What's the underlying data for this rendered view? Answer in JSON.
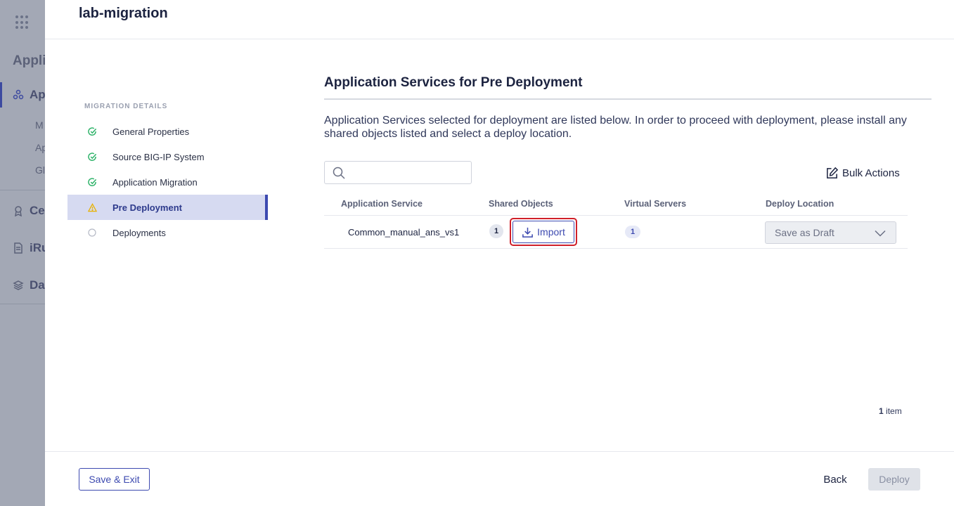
{
  "background": {
    "title": "Appli",
    "nav": [
      {
        "label": "Ap",
        "icon": "applications-icon",
        "active": true
      },
      {
        "label": "Ce",
        "icon": "certificates-icon"
      },
      {
        "label": "iRu",
        "icon": "irules-icon"
      },
      {
        "label": "Da",
        "icon": "data-icon"
      }
    ],
    "sub": [
      "M",
      "Ap",
      "Gl"
    ]
  },
  "header": {
    "title": "lab-migration"
  },
  "steps": {
    "label": "MIGRATION DETAILS",
    "items": [
      {
        "label": "General Properties",
        "status": "done"
      },
      {
        "label": "Source BIG-IP System",
        "status": "done"
      },
      {
        "label": "Application Migration",
        "status": "done"
      },
      {
        "label": "Pre Deployment",
        "status": "warning"
      },
      {
        "label": "Deployments",
        "status": "pending"
      }
    ]
  },
  "main": {
    "title": "Application Services for Pre Deployment",
    "description": "Application Services selected for deployment are listed below. In order to proceed with deployment, please install any shared objects listed and select a deploy location.",
    "search_placeholder": "",
    "bulk_actions_label": "Bulk Actions"
  },
  "table": {
    "columns": [
      "Application Service",
      "Shared Objects",
      "Virtual Servers",
      "Deploy Location"
    ],
    "rows": [
      {
        "application_service": "Common_manual_ans_vs1",
        "shared_objects": "1",
        "import_label": "Import",
        "virtual_servers": "1",
        "deploy_location": "Save as Draft"
      }
    ],
    "count": "1",
    "count_suffix": "item"
  },
  "footer": {
    "save_exit_label": "Save & Exit",
    "back_label": "Back",
    "deploy_label": "Deploy"
  },
  "colors": {
    "accent": "#3d4ab0",
    "success": "#2fb36a",
    "warning": "#e8b100",
    "highlight": "#d0202a"
  }
}
